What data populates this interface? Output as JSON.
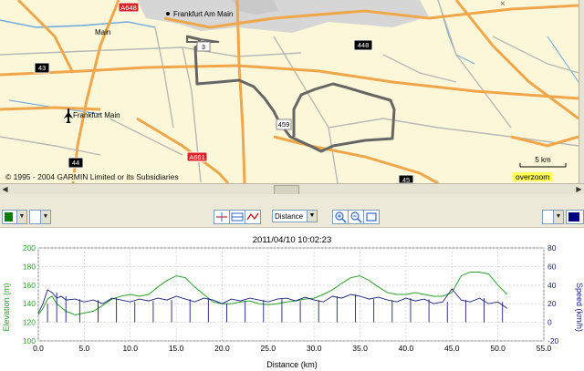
{
  "map": {
    "copyright": "© 1995 - 2004 GARMIN Limited or its Subsidiaries",
    "overzoom": "overzoom",
    "scale_label": "5 km",
    "place_labels": {
      "frankfurt_am_main": "Frankfurt Am Main",
      "main": "Main",
      "frankfurt_main_airport": "Frankfurt Main"
    },
    "road_labels": {
      "a648": "A648",
      "a661": "A661",
      "r43": "43",
      "r44": "44",
      "r45": "45",
      "r448": "448",
      "r459": "459",
      "r3": "3"
    },
    "colors": {
      "background": "#fbf7d8",
      "major_road": "#f0a64a",
      "minor_road": "#b8b8b8",
      "water": "#6aa6e0",
      "urban": "#d6d6d6",
      "track": "#666666"
    }
  },
  "toolbar": {
    "color_left": "#008000",
    "color_right": "#000080",
    "axis_select": "Distance",
    "icons": [
      "fit-width-icon",
      "fit-height-icon",
      "line-graph-icon",
      "zoom-in-icon",
      "zoom-out-icon",
      "zoom-fit-icon"
    ]
  },
  "chart_data": {
    "type": "line",
    "title": "2011/04/10 10:02:23",
    "xlabel": "Distance (km)",
    "ylabel": "Elevation (m)",
    "y2label": "Speed (km/h)",
    "xlim": [
      0,
      55
    ],
    "ylim": [
      100,
      200
    ],
    "y2lim": [
      -20,
      80
    ],
    "xticks": [
      "0.0",
      "5.0",
      "10.0",
      "15.0",
      "20.0",
      "25.0",
      "30.0",
      "35.0",
      "40.0",
      "45.0",
      "50.0",
      "55.0"
    ],
    "yticks": [
      "100",
      "120",
      "140",
      "160",
      "180",
      "200"
    ],
    "y2ticks": [
      "-20",
      "0",
      "20",
      "40",
      "60",
      "80"
    ],
    "grid": true,
    "series": [
      {
        "axis": "left",
        "color": "#2ca02c",
        "x": [
          0,
          0.5,
          1,
          1.5,
          2,
          3,
          4,
          5,
          6,
          7,
          8,
          9,
          10,
          11,
          12,
          13,
          14,
          15,
          16,
          17,
          18,
          19,
          20,
          21,
          22,
          23,
          24,
          25,
          26,
          27,
          28,
          29,
          30,
          31,
          32,
          33,
          34,
          35,
          36,
          37,
          38,
          39,
          40,
          41,
          42,
          43,
          44,
          45,
          46,
          47,
          48,
          49,
          50,
          51
        ],
        "values": [
          128,
          135,
          145,
          148,
          140,
          132,
          128,
          130,
          132,
          138,
          145,
          148,
          150,
          148,
          150,
          158,
          165,
          170,
          168,
          158,
          150,
          142,
          140,
          140,
          142,
          143,
          140,
          139,
          140,
          142,
          143,
          145,
          146,
          150,
          155,
          162,
          168,
          170,
          165,
          158,
          152,
          150,
          150,
          152,
          150,
          148,
          148,
          152,
          170,
          174,
          174,
          172,
          160,
          150
        ]
      },
      {
        "axis": "right",
        "color": "#1a237e",
        "x": [
          0,
          0.5,
          1,
          1.5,
          2,
          2.5,
          3,
          4,
          5,
          6,
          7,
          8,
          9,
          10,
          11,
          12,
          13,
          14,
          15,
          16,
          17,
          18,
          19,
          20,
          21,
          22,
          23,
          24,
          25,
          26,
          27,
          28,
          29,
          30,
          31,
          32,
          33,
          34,
          35,
          36,
          37,
          38,
          39,
          40,
          41,
          42,
          43,
          44,
          45,
          46,
          47,
          48,
          49,
          50,
          51
        ],
        "values": [
          10,
          20,
          35,
          32,
          26,
          28,
          24,
          25,
          22,
          24,
          20,
          26,
          24,
          22,
          25,
          23,
          26,
          24,
          28,
          25,
          22,
          26,
          24,
          20,
          25,
          23,
          26,
          24,
          22,
          25,
          26,
          23,
          27,
          24,
          22,
          28,
          26,
          30,
          28,
          25,
          27,
          24,
          22,
          26,
          23,
          25,
          20,
          22,
          36,
          24,
          22,
          26,
          20,
          22,
          15
        ]
      }
    ]
  }
}
